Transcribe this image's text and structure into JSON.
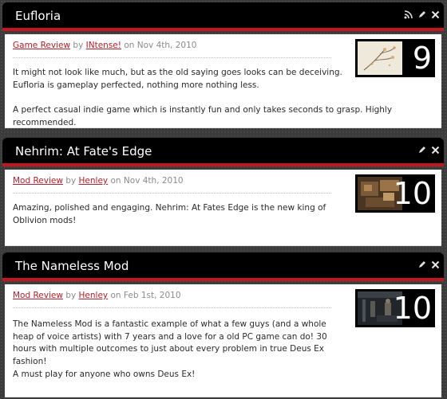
{
  "reviews": [
    {
      "title": "Eufloria",
      "type_label": "Game Review",
      "by": "by",
      "author": "INtense!",
      "on": "on",
      "date": "Nov 4th, 2010",
      "score": "9",
      "paragraphs": [
        "It might not look like much, but as the old saying goes looks can be deceiving. Eufloria is gameplay perfected, nothing more nothing less.",
        "A perfect casual indie game which is instantly fun and only takes seconds to grasp. Highly recommended."
      ],
      "controls": [
        "rss-icon",
        "edit-icon",
        "close-icon"
      ]
    },
    {
      "title": "Nehrim: At Fate's Edge",
      "type_label": "Mod Review",
      "by": "by",
      "author": "Henley",
      "on": "on",
      "date": "Nov 4th, 2010",
      "score": "10",
      "paragraphs": [
        "Amazing, polished and engaging. Nehrim: At Fates Edge is the new king of Oblivion mods!"
      ],
      "controls": [
        "edit-icon",
        "close-icon"
      ]
    },
    {
      "title": "The Nameless Mod",
      "type_label": "Mod Review",
      "by": "by",
      "author": "Henley",
      "on": "on",
      "date": "Feb 1st, 2010",
      "score": "10",
      "paragraphs": [
        "The Nameless Mod is a fantastic example of what a few guys (and a whole heap of voice artists) with 7 years and a love for a old PC game can do! 30 hours with multiple outcomes to just about every problem in true Deus Ex fashion!",
        "A must play for anyone who owns Deus Ex!"
      ],
      "controls": [
        "edit-icon",
        "close-icon"
      ]
    }
  ]
}
